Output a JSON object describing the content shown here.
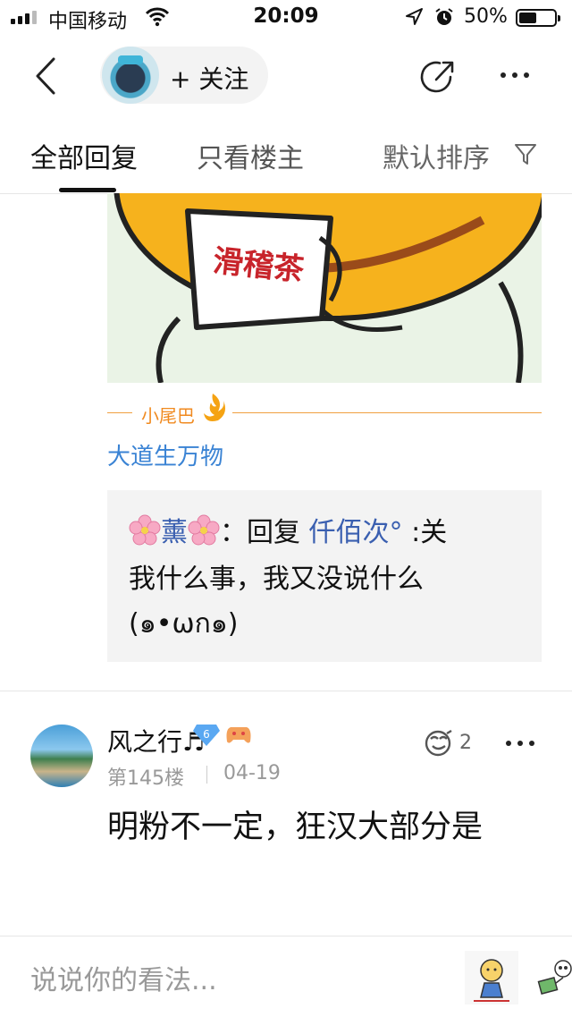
{
  "status_bar": {
    "carrier": "中国移动",
    "time": "20:09",
    "battery_percent": "50%",
    "battery_level": 0.5
  },
  "header": {
    "follow_label": "+ 关注"
  },
  "tabs": [
    {
      "label": "全部回复",
      "active": true
    },
    {
      "label": "只看楼主",
      "active": false
    },
    {
      "label": "默认排序",
      "active": false
    }
  ],
  "meme": {
    "cup_text": "滑稽茶"
  },
  "tail": {
    "label": "小尾巴",
    "text": "大道生万物"
  },
  "quoted_reply": {
    "author": "薰",
    "colon": "：",
    "reply_word": "回复",
    "target": "仟佰次°",
    "line1_rest": ":关",
    "line2": "我什么事，我又没说什么",
    "line3": "(๑•ωก๑)"
  },
  "post": {
    "username": "风之行♬",
    "level": "6",
    "floor": "第145楼",
    "date": "04-19",
    "like_count": "2",
    "body": "明粉不一定，狂汉大部分是"
  },
  "comment_bar": {
    "placeholder": "说说你的看法..."
  },
  "colors": {
    "link_blue": "#3a83d4",
    "name_blue": "#3a5fb0",
    "tail_orange": "#f08a20",
    "reply_bg": "#f3f3f3"
  }
}
